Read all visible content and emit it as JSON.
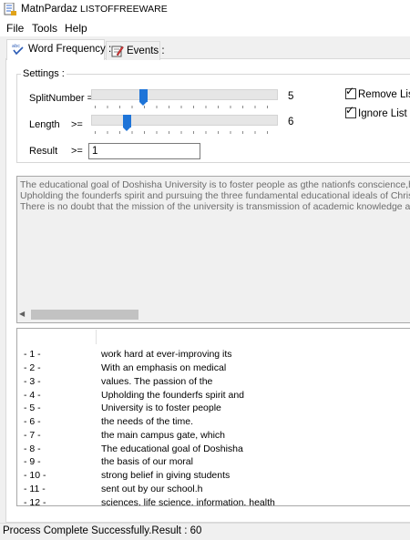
{
  "window": {
    "title": "MatnPardaz",
    "subtitle": "LISTOFFREEWARE"
  },
  "menu": {
    "items": [
      "File",
      "Tools",
      "Help"
    ]
  },
  "tabs": [
    {
      "label": "Word Frequency :",
      "icon": "abc-check-icon",
      "active": true
    },
    {
      "label": "Events :",
      "icon": "notepad-pencil-icon",
      "active": false
    }
  ],
  "settings": {
    "legend": "Settings :",
    "split_number": {
      "label": "SplitNumber =",
      "value": "5",
      "level_fraction": 0.27
    },
    "length": {
      "label": "Length",
      "operator": ">=",
      "value": "6",
      "level_fraction": 0.18
    },
    "result": {
      "label": "Result",
      "operator": ">=",
      "value": "1"
    },
    "remove_list": {
      "label": "Remove List",
      "checked": true
    },
    "ignore_list": {
      "label": "Ignore List",
      "checked": true
    }
  },
  "text_area": {
    "lines": [
      "The educational goal of Doshisha University is to foster people as gthe nationfs conscience,h and the b",
      "Upholding the founderfs spirit and pursuing the three fundamental educational ideals of Christian princi",
      "There is no doubt that the mission of the university is transmission of academic knowledge and expertis"
    ]
  },
  "results": {
    "rows": [
      {
        "num": "- 1 -",
        "text": "work hard at ever-improving its"
      },
      {
        "num": "- 2 -",
        "text": "With an emphasis on medical"
      },
      {
        "num": "- 3 -",
        "text": "values. The passion of the"
      },
      {
        "num": "- 4 -",
        "text": "Upholding the founderfs spirit and"
      },
      {
        "num": "- 5 -",
        "text": "University is to foster people"
      },
      {
        "num": "- 6 -",
        "text": "the needs of the time."
      },
      {
        "num": "- 7 -",
        "text": "the main campus gate, which"
      },
      {
        "num": "- 8 -",
        "text": "The educational goal of Doshisha"
      },
      {
        "num": "- 9 -",
        "text": "the basis of our moral"
      },
      {
        "num": "- 10 -",
        "text": "strong belief in giving students"
      },
      {
        "num": "- 11 -",
        "text": "sent out by our school.h"
      },
      {
        "num": "- 12 -",
        "text": "sciences, life science, information, health"
      }
    ]
  },
  "status": {
    "text": "Process Complete Successfully.Result : 60"
  },
  "colors": {
    "accent": "#1e74d8",
    "panel": "#ffffff",
    "chrome": "#f0f0f0"
  }
}
